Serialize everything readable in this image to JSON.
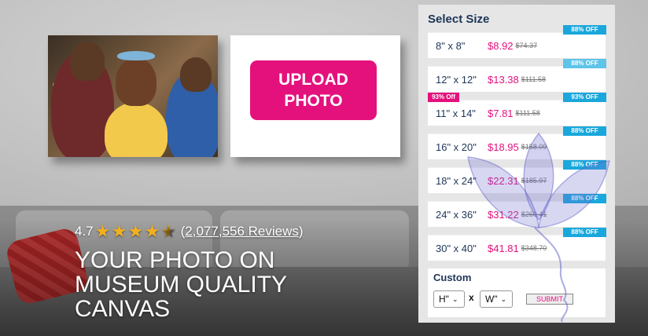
{
  "hero": {
    "upload_label": "UPLOAD PHOTO",
    "rating": "4.7",
    "reviews_link": "(2,077,556 Reviews)",
    "headline": "YOUR PHOTO ON MUSEUM QUALITY CANVAS"
  },
  "size_panel": {
    "title": "Select Size",
    "sizes": [
      {
        "label": "8\" x 8\"",
        "price": "$8.92",
        "old_price": "$74.37",
        "badge": "88% OFF"
      },
      {
        "label": "12\" x 12\"",
        "price": "$13.38",
        "old_price": "$111.58",
        "badge": "88% OFF"
      },
      {
        "label": "11\" x 14\"",
        "price": "$7.81",
        "old_price": "$111.58",
        "badge": "93% OFF",
        "promo": "93% Off"
      },
      {
        "label": "16\" x 20\"",
        "price": "$18.95",
        "old_price": "$158.09",
        "badge": "88% OFF"
      },
      {
        "label": "18\" x 24\"",
        "price": "$22.31",
        "old_price": "$185.97",
        "badge": "88% OFF"
      },
      {
        "label": "24\" x 36\"",
        "price": "$31.22",
        "old_price": "$260.41",
        "badge": "88% OFF"
      },
      {
        "label": "30\" x 40\"",
        "price": "$41.81",
        "old_price": "$348.70",
        "badge": "88% OFF"
      }
    ],
    "custom": {
      "title": "Custom",
      "height_value": "H\"",
      "width_value": "W\"",
      "separator": "x",
      "submit_label": "SUBMIT"
    }
  },
  "colors": {
    "brand_pink": "#e4117d",
    "badge_blue": "#1aa7dc",
    "navy": "#1d3557",
    "star": "#f2b01e"
  },
  "icons": [
    "star-icon",
    "star-half-icon",
    "chevron-down-icon",
    "leaf-logo-icon"
  ]
}
